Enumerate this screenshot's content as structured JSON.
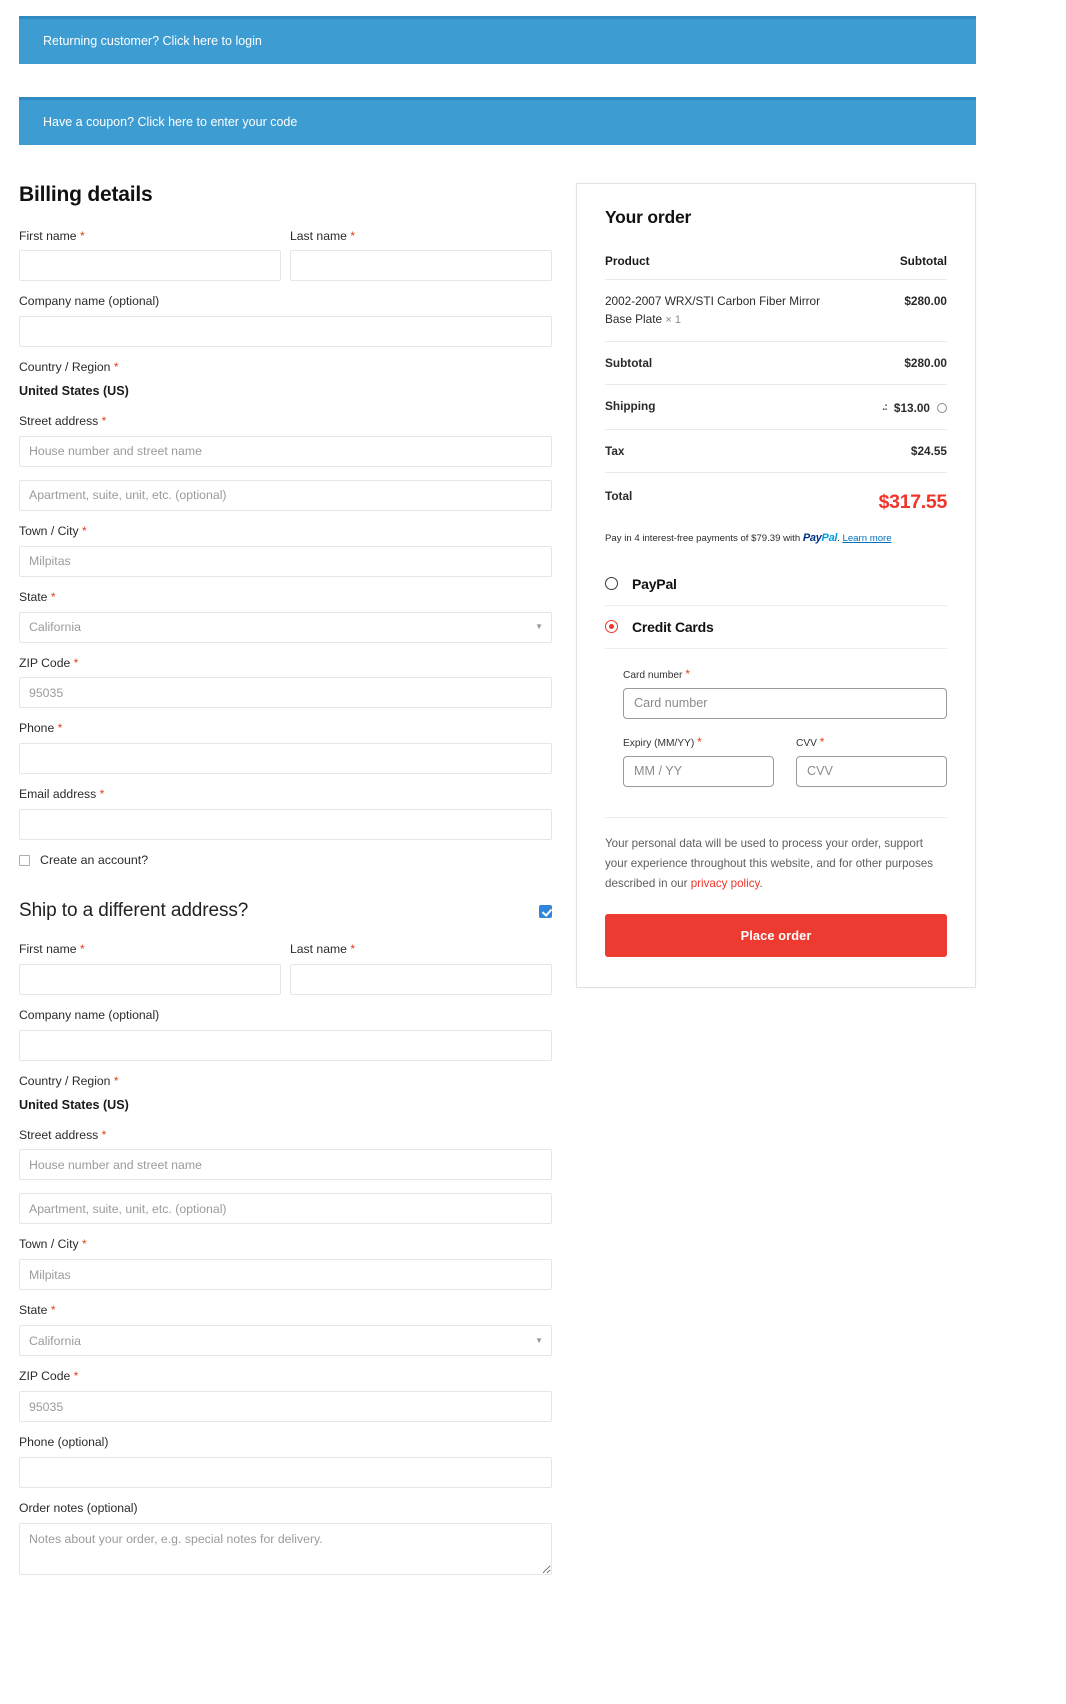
{
  "notices": [
    {
      "text": "Returning customer? Click here to login"
    },
    {
      "text": "Have a coupon? Click here to enter your code"
    }
  ],
  "billing": {
    "title": "Billing details",
    "first_name_label": "First name",
    "first_name_value": "",
    "last_name_label": "Last name",
    "last_name_value": "",
    "company_label": "Company name (optional)",
    "company_value": "",
    "country_label": "Country / Region",
    "country_value": "United States (US)",
    "street_label": "Street address",
    "street_placeholder": "House number and street name",
    "street2_placeholder": "Apartment, suite, unit, etc. (optional)",
    "city_label": "Town / City",
    "city_placeholder": "Milpitas",
    "state_label": "State",
    "state_placeholder": "California",
    "zip_label": "ZIP Code",
    "zip_placeholder": "95035",
    "phone_label": "Phone",
    "phone_value": "",
    "email_label": "Email address",
    "email_value": "",
    "create_account_label": "Create an account?",
    "create_account_checked": false,
    "required_mark": "*"
  },
  "shipping": {
    "title": "Ship to a different address?",
    "checked": true,
    "first_name_label": "First name",
    "last_name_label": "Last name",
    "company_label": "Company name (optional)",
    "country_label": "Country / Region",
    "country_value": "United States (US)",
    "street_label": "Street address",
    "street_placeholder": "House number and street name",
    "street2_placeholder": "Apartment, suite, unit, etc. (optional)",
    "city_label": "Town / City",
    "city_placeholder": "Milpitas",
    "state_label": "State",
    "state_placeholder": "California",
    "zip_label": "ZIP Code",
    "zip_placeholder": "95035",
    "phone_label": "Phone (optional)",
    "notes_label": "Order notes (optional)",
    "notes_placeholder": "Notes about your order, e.g. special notes for delivery."
  },
  "order": {
    "title": "Your order",
    "col_product": "Product",
    "col_subtotal": "Subtotal",
    "item_name": "2002-2007 WRX/STI Carbon Fiber Mirror Base Plate",
    "item_qty": "× 1",
    "item_price": "$280.00",
    "subtotal_label": "Subtotal",
    "subtotal_value": "$280.00",
    "shipping_label": "Shipping",
    "shipping_prefix": ".:",
    "shipping_value": "$13.00",
    "tax_label": "Tax",
    "tax_value": "$24.55",
    "total_label": "Total",
    "total_value": "$317.55",
    "paypal_msg_pre": "Pay in 4 interest-free payments of $79.39 with",
    "paypal_brand_1": "Pay",
    "paypal_brand_2": "Pal",
    "paypal_msg_post": ".",
    "paypal_learn": "Learn more"
  },
  "payment": {
    "paypal_label": "PayPal",
    "paypal_selected": false,
    "credit_label": "Credit Cards",
    "credit_selected": true,
    "card_number_label": "Card number",
    "card_number_placeholder": "Card number",
    "expiry_label": "Expiry (MM/YY)",
    "expiry_placeholder": "MM / YY",
    "cvv_label": "CVV",
    "cvv_placeholder": "CVV",
    "required_mark": "*",
    "privacy_text": "Your personal data will be used to process your order, support your experience throughout this website, and for other purposes described in our ",
    "privacy_link": "privacy policy",
    "privacy_end": ".",
    "place_order_label": "Place order"
  },
  "colors": {
    "notice_blue": "#3d9cd2",
    "accent_red": "#f0352b",
    "button_red": "#ee3b32",
    "checkbox_blue": "#2e86de"
  }
}
